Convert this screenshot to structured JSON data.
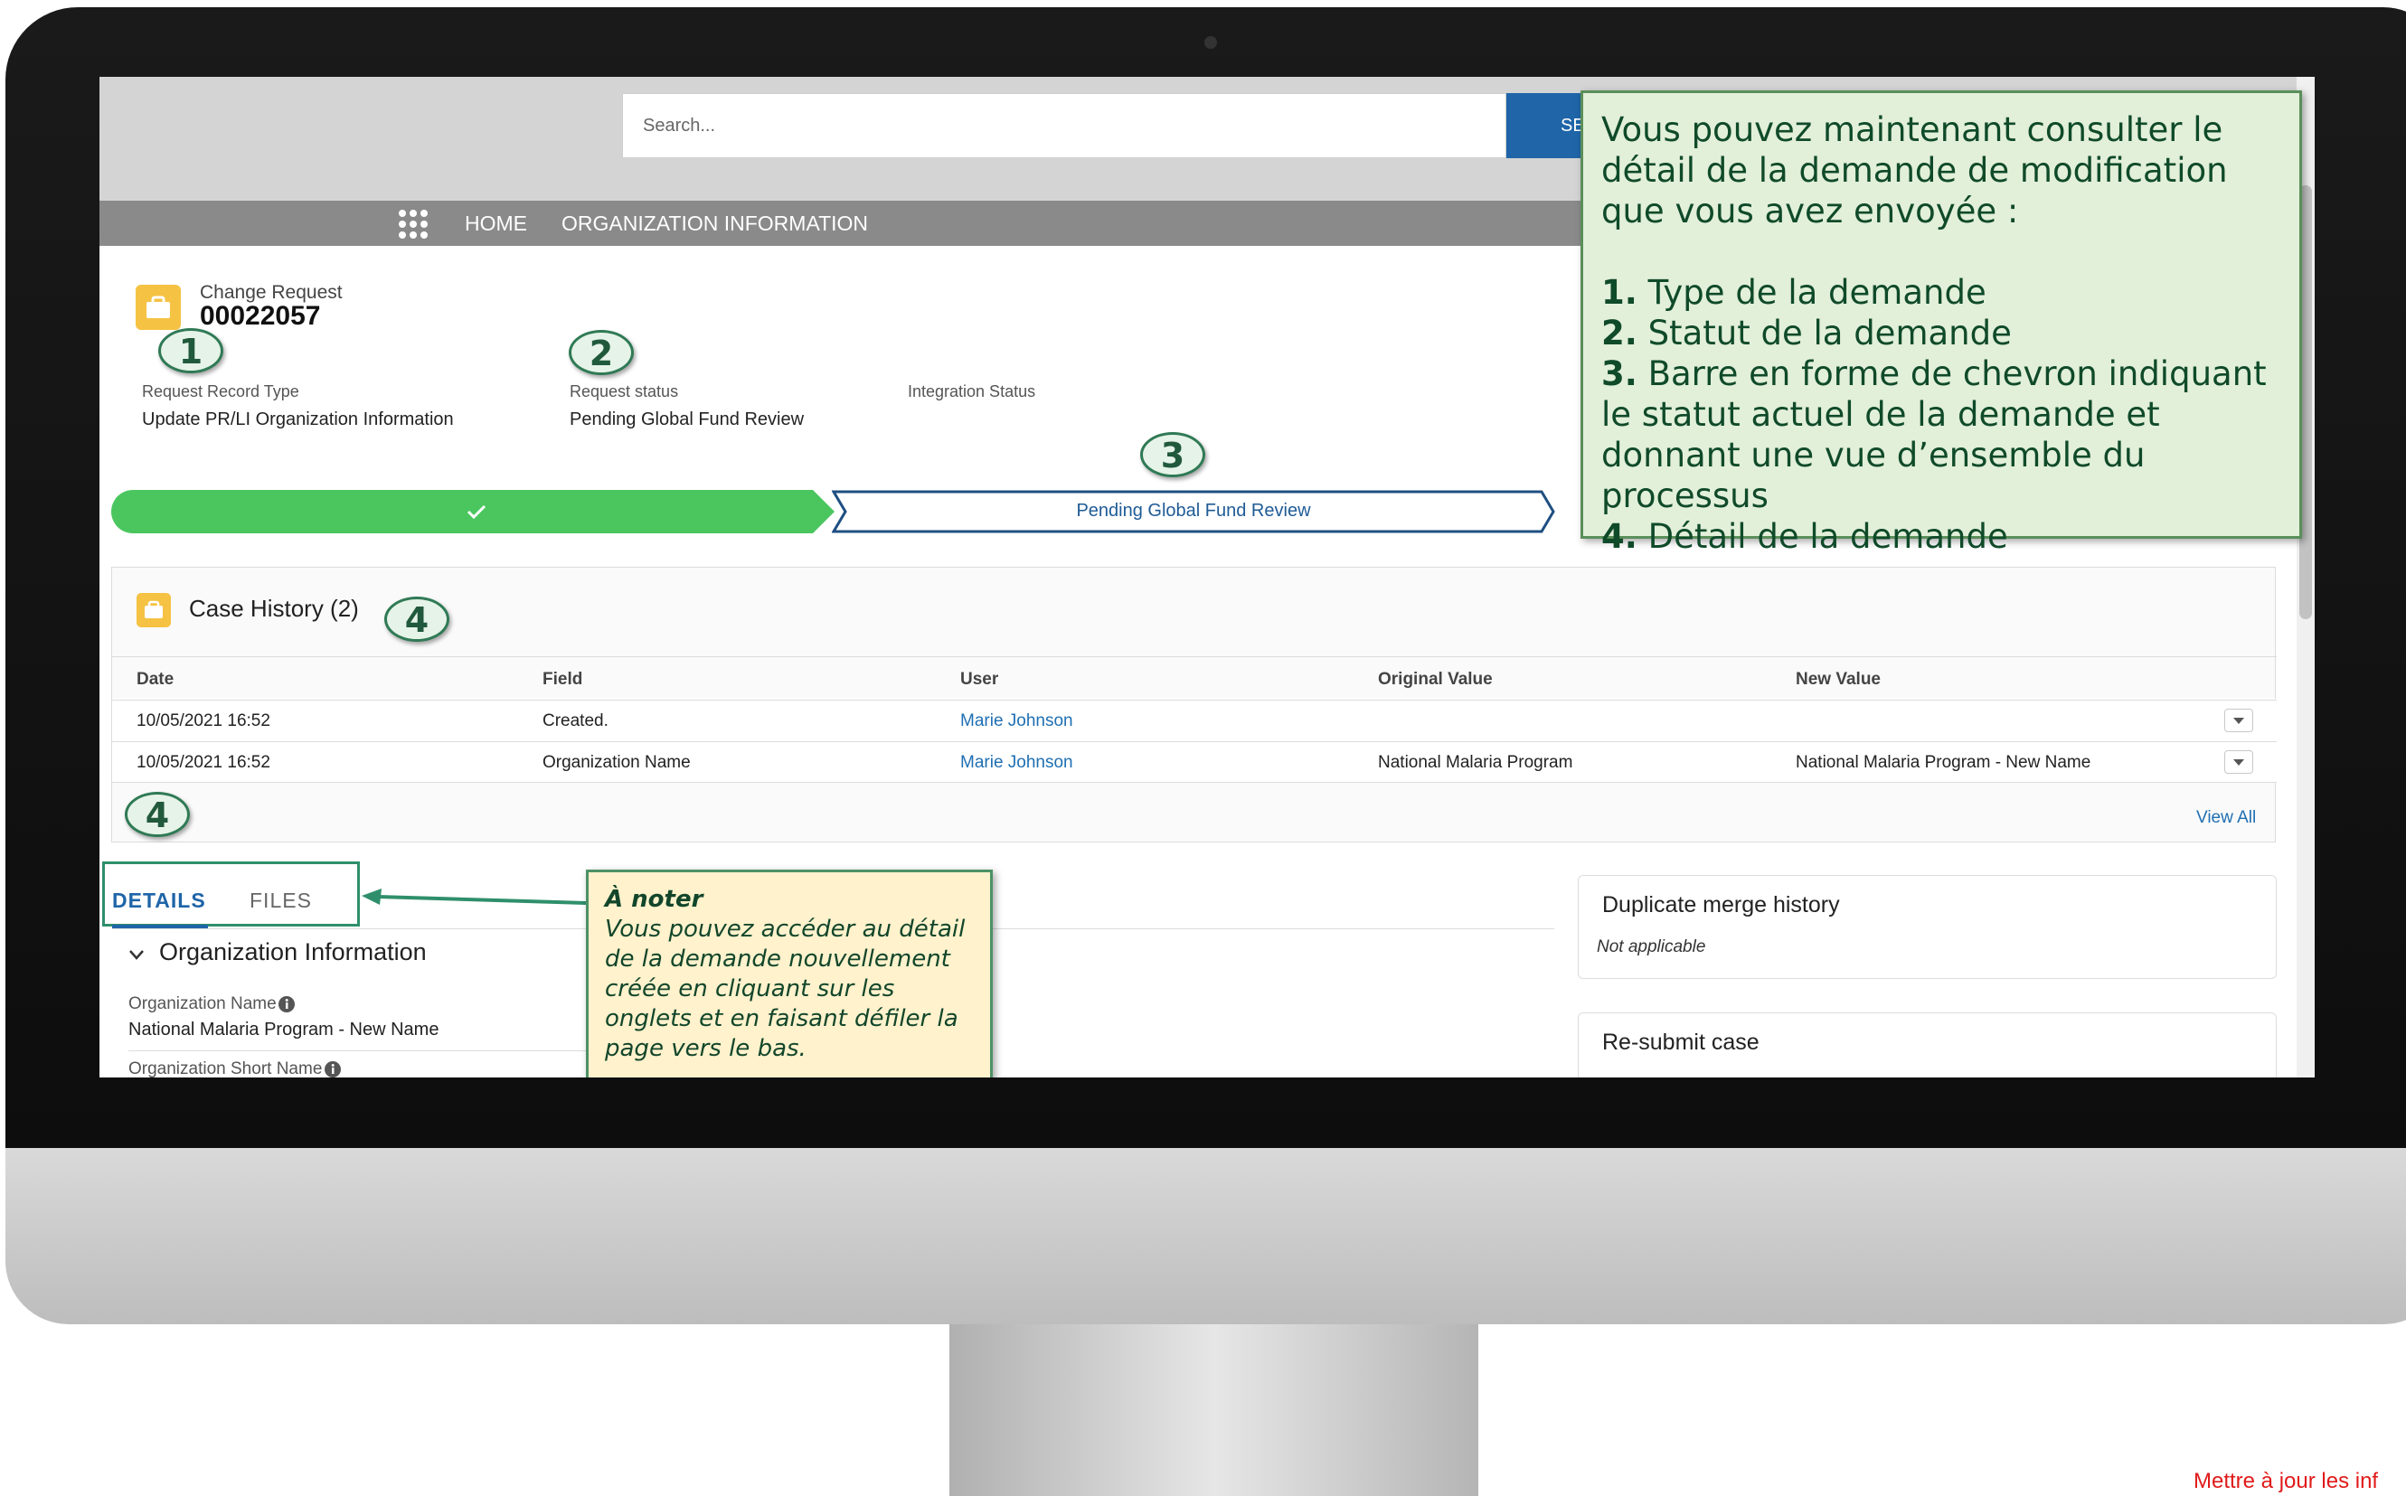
{
  "search": {
    "placeholder": "Search...",
    "button": "SE"
  },
  "nav": {
    "home": "HOME",
    "org_info": "ORGANIZATION INFORMATION"
  },
  "record": {
    "object_label": "Change Request",
    "number": "00022057",
    "fields": [
      {
        "label": "Request Record Type",
        "value": "Update PR/LI Organization Information"
      },
      {
        "label": "Request status",
        "value": "Pending Global Fund Review"
      },
      {
        "label": "Integration Status",
        "value": ""
      }
    ]
  },
  "path": {
    "current_step": "Pending Global Fund Review"
  },
  "case_history": {
    "title": "Case History (2)",
    "columns": [
      "Date",
      "Field",
      "User",
      "Original Value",
      "New Value"
    ],
    "rows": [
      {
        "date": "10/05/2021 16:52",
        "field": "Created.",
        "user": "Marie Johnson",
        "original": "",
        "new": ""
      },
      {
        "date": "10/05/2021 16:52",
        "field": "Organization Name",
        "user": "Marie Johnson",
        "original": "National Malaria Program",
        "new": "National Malaria Program - New Name"
      }
    ],
    "view_all": "View All"
  },
  "tabs": {
    "details": "DETAILS",
    "files": "FILES"
  },
  "org_section": {
    "title": "Organization Information",
    "name_label": "Organization Name",
    "name_value": "National Malaria Program - New Name",
    "short_name_label": "Organization Short Name"
  },
  "side": {
    "duplicate_title": "Duplicate merge history",
    "duplicate_value": "Not applicable",
    "resubmit_title": "Re-submit case"
  },
  "markers": {
    "m1": "1",
    "m2": "2",
    "m3": "3",
    "m4a": "4",
    "m4b": "4"
  },
  "callout": {
    "intro": "Vous pouvez maintenant consulter le détail de la demande de modification que vous avez envoyée :",
    "items": [
      {
        "num": "1.",
        "text": " Type de la demande"
      },
      {
        "num": "2.",
        "text": " Statut de la demande"
      },
      {
        "num": "3.",
        "text": " Barre en forme de chevron indiquant le statut actuel de la demande et donnant une vue d’ensemble du processus"
      },
      {
        "num": "4.",
        "text": " Détail de la demande"
      }
    ]
  },
  "note": {
    "title": "À noter",
    "body": "Vous pouvez accéder au détail de la demande nouvellement créée en cliquant sur les onglets et en faisant défiler la page vers le bas."
  },
  "footer_text": "Mettre à jour les inf",
  "colors": {
    "brand": "#1f65a8",
    "path_done": "#4bc65f",
    "callout_bg": "#e2efd9",
    "note_bg": "#fff2cc",
    "icon_yellow": "#f5c243"
  },
  "icons": [
    "app-launcher-icon",
    "briefcase-icon",
    "checkmark-icon",
    "chevron-down-icon",
    "info-icon",
    "dropdown-arrow-icon"
  ]
}
